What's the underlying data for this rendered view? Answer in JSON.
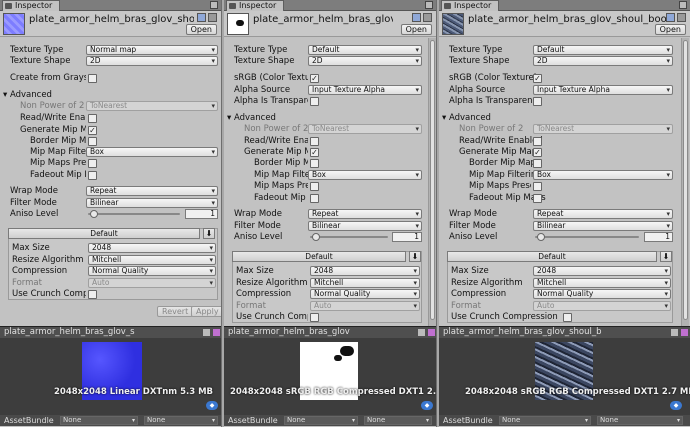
{
  "panels": [
    {
      "tab": "Inspector",
      "title": "plate_armor_helm_bras_glov_shoul_boo",
      "open": "Open",
      "texture_type_label": "Texture Type",
      "texture_type": "Normal map",
      "texture_shape_label": "Texture Shape",
      "texture_shape": "2D",
      "create_gray": "Create from Graysc",
      "advanced": "Advanced",
      "npot_label": "Non Power of 2",
      "npot": "ToNearest",
      "rw": "Read/Write Enable",
      "genmip": "Generate Mip Map",
      "border": "Border Mip Map",
      "mipfilter_label": "Mip Map Filterin",
      "mipfilter": "Box",
      "mipmaps_preserve": "Mip Maps Prese",
      "fadeout": "Fadeout Mip Ma",
      "wrap_label": "Wrap Mode",
      "wrap": "Repeat",
      "filter_label": "Filter Mode",
      "filter": "Bilinear",
      "aniso_label": "Aniso Level",
      "aniso": "1",
      "platform": "Default",
      "maxsize_label": "Max Size",
      "maxsize": "2048",
      "resize_label": "Resize Algorithm",
      "resize": "Mitchell",
      "compression_label": "Compression",
      "compression": "Normal Quality",
      "format_label": "Format",
      "format": "Auto",
      "crunch": "Use Crunch Compre",
      "revert": "Revert",
      "apply": "Apply",
      "preview_title": "plate_armor_helm_bras_glov_s",
      "preview_info": "2048x2048 Linear  DXTnm   5.3 MB",
      "assetbundle_label": "AssetBundle",
      "ab1": "None",
      "ab2": "None"
    },
    {
      "tab": "Inspector",
      "title": "plate_armor_helm_bras_glov_shoul_",
      "open": "Open",
      "texture_type_label": "Texture Type",
      "texture_type": "Default",
      "texture_shape_label": "Texture Shape",
      "texture_shape": "2D",
      "srgb": "sRGB (Color Texture",
      "alpha_source_label": "Alpha Source",
      "alpha_source": "Input Texture Alpha",
      "alpha_transp": "Alpha Is Transparen",
      "advanced": "Advanced",
      "npot_label": "Non Power of 2",
      "npot": "ToNearest",
      "rw": "Read/Write Enable",
      "genmip": "Generate Mip Map",
      "border": "Border Mip Map",
      "mipfilter_label": "Mip Map Filterin",
      "mipfilter": "Box",
      "mipmaps_preserve": "Mip Maps Prese",
      "fadeout": "Fadeout Mip Ma",
      "wrap_label": "Wrap Mode",
      "wrap": "Repeat",
      "filter_label": "Filter Mode",
      "filter": "Bilinear",
      "aniso_label": "Aniso Level",
      "aniso": "1",
      "platform": "Default",
      "maxsize_label": "Max Size",
      "maxsize": "2048",
      "resize_label": "Resize Algorithm",
      "resize": "Mitchell",
      "compression_label": "Compression",
      "compression": "Normal Quality",
      "format_label": "Format",
      "format": "Auto",
      "crunch": "Use Crunch Compre",
      "preview_title": "plate_armor_helm_bras_glov",
      "preview_info": "2048x2048 sRGB  RGB Compressed DXT1   2.7 MB",
      "assetbundle_label": "AssetBundle",
      "ab1": "None",
      "ab2": "None"
    },
    {
      "tab": "Inspector",
      "title": "plate_armor_helm_bras_glov_shoul_boots_All",
      "open": "Open",
      "texture_type_label": "Texture Type",
      "texture_type": "Default",
      "texture_shape_label": "Texture Shape",
      "texture_shape": "2D",
      "srgb": "sRGB (Color Texture)",
      "alpha_source_label": "Alpha Source",
      "alpha_source": "Input Texture Alpha",
      "alpha_transp": "Alpha Is Transparency",
      "advanced": "Advanced",
      "npot_label": "Non Power of 2",
      "npot": "ToNearest",
      "rw": "Read/Write Enabled",
      "genmip": "Generate Mip Maps",
      "border": "Border Mip Map",
      "mipfilter_label": "Mip Map Filtering",
      "mipfilter": "Box",
      "mipmaps_preserve": "Mip Maps Preserv",
      "fadeout": "Fadeout Mip Maps",
      "wrap_label": "Wrap Mode",
      "wrap": "Repeat",
      "filter_label": "Filter Mode",
      "filter": "Bilinear",
      "aniso_label": "Aniso Level",
      "aniso": "1",
      "platform": "Default",
      "maxsize_label": "Max Size",
      "maxsize": "2048",
      "resize_label": "Resize Algorithm",
      "resize": "Mitchell",
      "compression_label": "Compression",
      "compression": "Normal Quality",
      "format_label": "Format",
      "format": "Auto",
      "crunch": "Use Crunch Compression",
      "preview_title": "plate_armor_helm_bras_glov_shoul_b",
      "preview_info": "2048x2048 sRGB  RGB Compressed DXT1   2.7 MB",
      "assetbundle_label": "AssetBundle",
      "ab1": "None",
      "ab2": "None"
    }
  ],
  "checks": {
    "generate_mip": "✓",
    "srgb": "✓"
  },
  "icons": [
    "inspector-tab-icon",
    "settings-icon",
    "lock-icon",
    "download-icon",
    "menu-icon"
  ],
  "colors": {
    "normal_map": "#8c8cff",
    "accent": "#3b78d0"
  }
}
